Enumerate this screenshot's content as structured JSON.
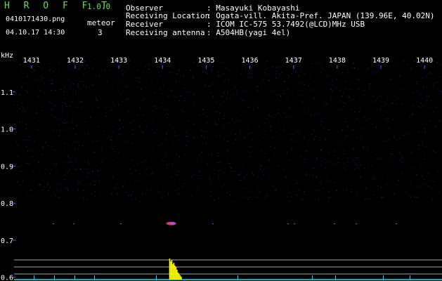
{
  "app": {
    "title": "H R O F F T",
    "version": "1.0.0"
  },
  "file": {
    "name": "0410171430.png",
    "datetime": "04.10.17 14:30"
  },
  "meteor": {
    "label": "meteor",
    "count": "3"
  },
  "info": {
    "rows": [
      {
        "key": "Observer",
        "value": ": Masayuki Kobayashi"
      },
      {
        "key": "Receiving Location",
        "value": ": Ogata-vill. Akita-Pref. JAPAN (139.96E, 40.02N)"
      },
      {
        "key": "Receiver",
        "value": ": ICOM IC-575 53.7492(@LCD)MHz USB"
      },
      {
        "key": "Receiving antenna",
        "value": ": A504HB(yagi 4el)"
      }
    ]
  },
  "colors": {
    "title_green": "#5de35d",
    "text": "#ffffff",
    "tick": "#5a5aff",
    "speck": "#1e2a6e",
    "signal": "#ff3b8d",
    "spectrum": "#ffff00",
    "baseline": "#00e5ff"
  },
  "chart_data": {
    "type": "heatmap",
    "x_unit_label": "kHz",
    "x_ticks": [
      "1431",
      "1432",
      "1433",
      "1434",
      "1435",
      "1436",
      "1437",
      "1438",
      "1439",
      "1440"
    ],
    "x_range": [
      1430.6,
      1440.4
    ],
    "y_ticks": [
      "1.1",
      "1.0",
      "0.9",
      "0.8",
      "0.7",
      "0.6"
    ],
    "y_range": [
      0.59,
      1.2
    ],
    "signal_band_y": 0.745,
    "echo": {
      "x": 1434.2,
      "y": 0.745
    }
  }
}
